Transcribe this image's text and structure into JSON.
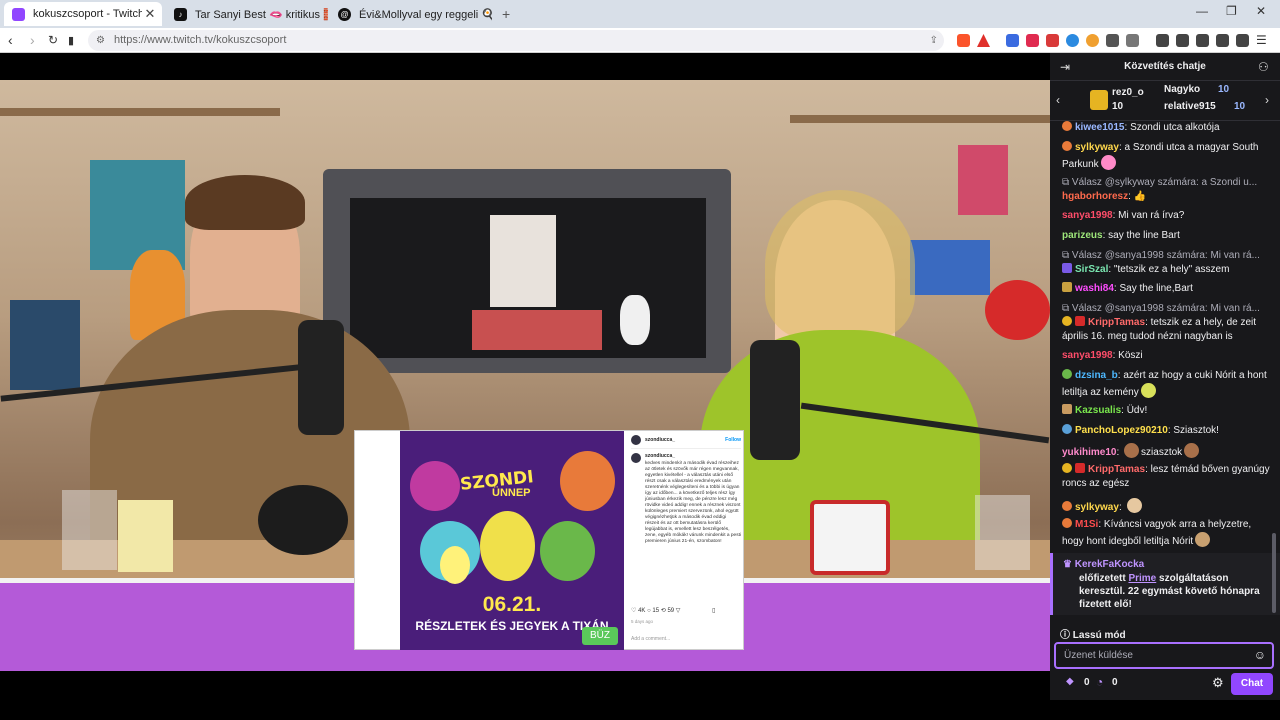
{
  "browser": {
    "tabs": [
      {
        "title": "kokuszcsoport - Twitch",
        "icon": "twitch-icon",
        "color": "#9146ff",
        "active": true
      },
      {
        "title": "Tar Sanyi Best 🫦 kritikus 🧱 (@szop...",
        "icon": "tiktok-icon",
        "color": "#111111",
        "active": false
      },
      {
        "title": "Évi&Mollyval egy reggeli 🍳😍 (@m...",
        "icon": "threads-icon",
        "color": "#111111",
        "active": false
      }
    ],
    "new_tab": "+",
    "url": "https://www.twitch.tv/kokuszcsoport"
  },
  "post": {
    "poster_title": "SZONDI",
    "poster_sub": "ÜNNEP",
    "poster_date": "06.21.",
    "poster_info": "RÉSZLETEK ÉS JEGYEK A TIXÁN",
    "poster_tag": "BÜZ",
    "account": "szondiucca_",
    "follow": "Follow",
    "caption_user": "szondiucca_",
    "caption": "kedves mindenki! a második évad részeihez az ötletek és szövők már régen megvannak, egyetlen kivétellel - a választás utáni első részt csak a választási eredmények után szeretnénk véglegesíteni és a többi is úgyan így az időben... a következő teljes rész így júniusban érkezik meg, de pénzre lesz még rövidke videó addig! ennek a résznek viszont különleges premiert szervezünk, ahol együtt végignézhetjük a második évad eddigi részeit és az ott bemutatásra kerülő legújabbat is, emellett lesz beszélgetés, zene, egyéb mókák! várunk mindenkit a pesti premieren június 21-én, szombaton!",
    "likes": "4K",
    "comments": "15",
    "shares": "59",
    "ago": "5 days ago",
    "add_comment": "Add a comment..."
  },
  "chat": {
    "title": "Közvetítés chatje",
    "gifts": [
      {
        "name": "rez0_o",
        "count": "10"
      },
      {
        "name": "Nagyko",
        "count": "10"
      },
      {
        "name": "relative915",
        "count": "10"
      }
    ],
    "messages": [
      {
        "user": "kiwee1015",
        "color": "#9ab8ff",
        "text": "Szondi utca alkotója"
      },
      {
        "user": "sylkyway",
        "color": "#ffd84d",
        "text": "a Szondi utca a magyar South Parkunk"
      },
      {
        "reply": "Válasz @sylkyway számára: a Szondi u...",
        "user": "hgaborhoresz",
        "color": "#ff6a4d",
        "text": "👍"
      },
      {
        "user": "sanya1998",
        "color": "#ff4d6a",
        "text": "Mi van rá írva?"
      },
      {
        "user": "parizeus",
        "color": "#9ee67a",
        "text": "say the line Bart"
      },
      {
        "reply": "Válasz @sanya1998 számára: Mi van rá...",
        "user": "SirSzal",
        "color": "#7ae6b0",
        "text": "\"tetszik ez a hely\" asszem"
      },
      {
        "user": "washi84",
        "color": "#ff4dff",
        "text": "Say the line,Bart"
      },
      {
        "reply": "Válasz @sanya1998 számára: Mi van rá...",
        "user": "KrippTamas",
        "color": "#ff6a6a",
        "text": "tetszik ez a hely, de zeit április 16. meg tudod nézni nagyban is"
      },
      {
        "user": "sanya1998",
        "color": "#ff4d6a",
        "text": "Köszi"
      },
      {
        "user": "dzsina_b",
        "color": "#4db8ff",
        "text": "azért az hogy a cuki Nórit a hont letiltja az kemény"
      },
      {
        "user": "Kazsualis",
        "color": "#7ae64d",
        "text": "Üdv!"
      },
      {
        "user": "PanchoLopez90210",
        "color": "#ffe04d",
        "text": "Sziasztok!"
      },
      {
        "user": "yukihime10",
        "color": "#ff8acb",
        "text": "sziasztok"
      },
      {
        "user": "KrippTamas",
        "color": "#ff6a6a",
        "text": "lesz témád bőven gyanúgy roncs az egész"
      },
      {
        "user": "sylkyway",
        "color": "#ffd84d",
        "text": ""
      },
      {
        "user": "M1Si",
        "color": "#ff4d4d",
        "text": "Kíváncsi vagyok arra a helyzetre, hogy hont idegből letiltja Nórit"
      }
    ],
    "sub_notice": {
      "user": "KerekFaKocka",
      "text_before": "előfizetett ",
      "link": "Prime",
      "text_after": " szolgáltatáson keresztül. 22 egymást követő hónapra fizetett elő!"
    },
    "slow_mode": "Lassú mód",
    "input_placeholder": "Üzenet küldése",
    "bits": "0",
    "points": "0",
    "chat_button": "Chat"
  }
}
